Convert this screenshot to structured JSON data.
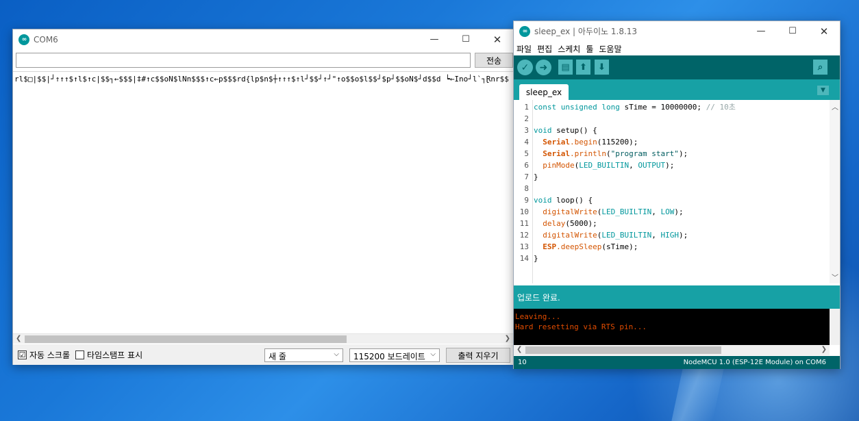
{
  "serial_window": {
    "title": "COM6",
    "send_label": "전송",
    "send_input_value": "",
    "output_text": "rl$□|$$|┘↑↑↑$↑l$↑c|$$┐←$$$|‡#↑c$$oN$lNn$$$↑c←p$$$rd{lp$n$┼↑↑↑$↑l┘$$┘↑┘\"↑o$$o$l$$┘$p┘$$oN$┘d$$d ┕←Ino┘l`┐Ɽnr$$",
    "autoscroll_label": "자동 스크롤",
    "autoscroll_checked": "☑",
    "timestamp_label": "타임스탬프 표시",
    "line_ending": "새 줄",
    "baud": "115200 보드레이트",
    "clear_label": "출력 지우기"
  },
  "ide_window": {
    "title": "sleep_ex | 아두이노 1.8.13",
    "menu": [
      "파일",
      "편집",
      "스케치",
      "툴",
      "도움말"
    ],
    "tab": "sleep_ex",
    "line_numbers": [
      "1",
      "2",
      "3",
      "4",
      "5",
      "6",
      "7",
      "8",
      "9",
      "10",
      "11",
      "12",
      "13",
      "14"
    ],
    "code": {
      "l1_a": "const unsigned long",
      "l1_b": " sTime = 10000000; ",
      "l1_c": "// 10초",
      "l3_a": "void",
      "l3_b": " setup",
      "l3_c": "() {",
      "l4_a": "  Serial",
      "l4_b": ".begin",
      "l4_c": "(115200);",
      "l5_a": "  Serial",
      "l5_b": ".println",
      "l5_c": "(",
      "l5_d": "\"program start\"",
      "l5_e": ");",
      "l6_a": "  pinMode",
      "l6_b": "(",
      "l6_c": "LED_BUILTIN",
      "l6_d": ", ",
      "l6_e": "OUTPUT",
      "l6_f": ");",
      "l7": "}",
      "l9_a": "void",
      "l9_b": " loop",
      "l9_c": "() {",
      "l10_a": "  digitalWrite",
      "l10_b": "(",
      "l10_c": "LED_BUILTIN",
      "l10_d": ", ",
      "l10_e": "LOW",
      "l10_f": ");",
      "l11_a": "  delay",
      "l11_b": "(5000);",
      "l12_a": "  digitalWrite",
      "l12_b": "(",
      "l12_c": "LED_BUILTIN",
      "l12_d": ", ",
      "l12_e": "HIGH",
      "l12_f": ");",
      "l13_a": "  ESP",
      "l13_b": ".deepSleep",
      "l13_c": "(sTime);",
      "l14": "}"
    },
    "status": "업로드 완료.",
    "console": [
      "Leaving...",
      "Hard resetting via RTS pin..."
    ],
    "footer_line": "10",
    "footer_board": "NodeMCU 1.0 (ESP-12E Module) on COM6"
  },
  "colors": {
    "teal_dark": "#006468",
    "teal": "#17a1a5",
    "teal_light": "#4db7bb",
    "keyword": "#00979c",
    "function": "#d35400",
    "console_text": "#e34c00"
  },
  "icons": {
    "app": "arduino-icon",
    "verify": "check-icon",
    "upload": "arrow-right-icon",
    "new": "file-icon",
    "open": "arrow-up-icon",
    "save": "arrow-down-icon",
    "serial": "magnifier-icon"
  }
}
